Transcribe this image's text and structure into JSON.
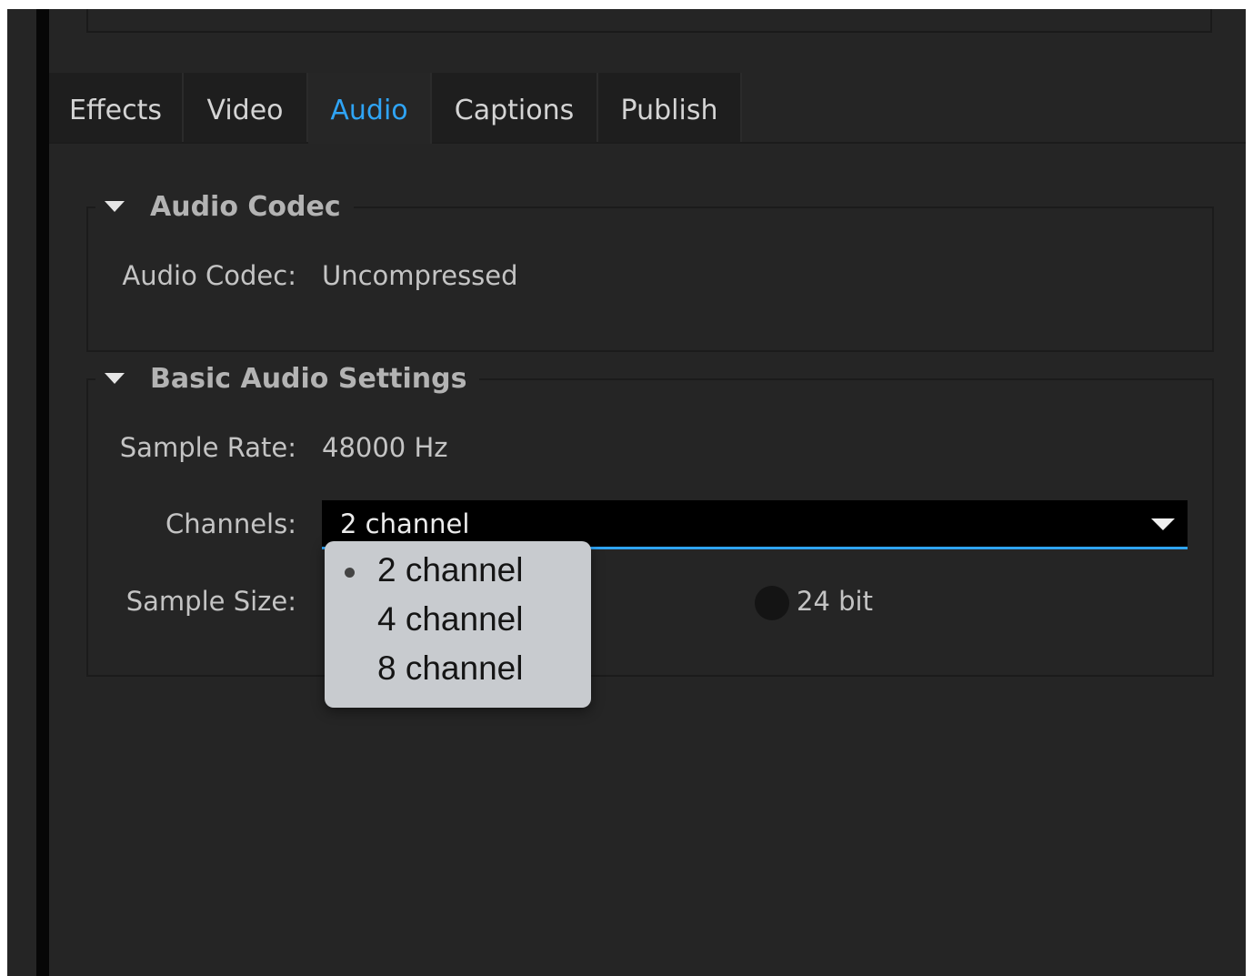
{
  "tabs": [
    {
      "label": "Effects"
    },
    {
      "label": "Video"
    },
    {
      "label": "Audio"
    },
    {
      "label": "Captions"
    },
    {
      "label": "Publish"
    }
  ],
  "active_tab": "Audio",
  "accent_color": "#2fa4f5",
  "audio_codec_section": {
    "title": "Audio Codec",
    "codec_label": "Audio Codec:",
    "codec_value": "Uncompressed"
  },
  "basic_audio_section": {
    "title": "Basic Audio Settings",
    "sample_rate_label": "Sample Rate:",
    "sample_rate_value": "48000 Hz",
    "channels_label": "Channels:",
    "channels_value": "2 channel",
    "sample_size_label": "Sample Size:",
    "sample_size_option": "24 bit"
  },
  "channels_menu": {
    "selected": "2 channel",
    "options": [
      {
        "label": "2 channel"
      },
      {
        "label": "4 channel"
      },
      {
        "label": "8 channel"
      }
    ]
  }
}
